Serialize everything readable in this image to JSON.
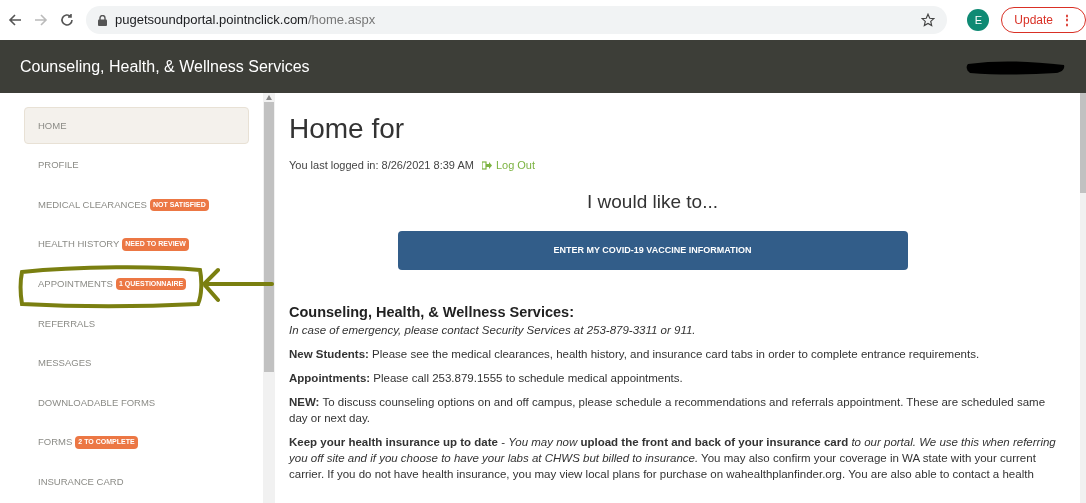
{
  "browser": {
    "url_host": "pugetsoundportal.pointnclick.com",
    "url_path": "/home.aspx",
    "avatar": "E",
    "update_button": "Update",
    "update_menu": "⋮"
  },
  "header": {
    "title": "Counseling, Health, & Wellness Services"
  },
  "sidebar": {
    "items": [
      {
        "label": "HOME",
        "selected": true
      },
      {
        "label": "PROFILE",
        "selected": false
      },
      {
        "label": "MEDICAL CLEARANCES",
        "badge": "NOT SATISFIED",
        "selected": false
      },
      {
        "label": "HEALTH HISTORY",
        "badge": "NEED TO REVIEW",
        "selected": false
      },
      {
        "label": "APPOINTMENTS",
        "badge": "1 QUESTIONNAIRE",
        "selected": false,
        "annotated": true
      },
      {
        "label": "REFERRALS",
        "selected": false
      },
      {
        "label": "MESSAGES",
        "selected": false
      },
      {
        "label": "DOWNLOADABLE FORMS",
        "selected": false
      },
      {
        "label": "FORMS",
        "badge": "2 TO COMPLETE",
        "selected": false
      },
      {
        "label": "INSURANCE CARD",
        "selected": false
      }
    ]
  },
  "main": {
    "title": "Home for",
    "last_login": "You last logged in: 8/26/2021 8:39 AM",
    "logout": "Log Out",
    "prompt": "I would like to...",
    "action_button": "ENTER MY COVID-19 VACCINE INFORMATION",
    "section_title": "Counseling, Health, & Wellness Services:",
    "paragraphs": [
      {
        "kind": "note",
        "text": "In case of emergency, please contact Security Services at 253-879-3311 or 911."
      },
      {
        "kind": "body",
        "text": "**New Students:** Please see the medical clearances, health history, and insurance card tabs in order to complete entrance requirements."
      },
      {
        "kind": "body",
        "text": "**Appointments:** Please call 253.879.1555 to schedule medical appointments."
      },
      {
        "kind": "body",
        "text": "**NEW:** To discuss counseling options on and off campus, please schedule a recommendations and referrals appointment. These are scheduled same day or next day."
      },
      {
        "kind": "body",
        "text": "**Keep your health insurance up to date** - *You may now* **upload the front and back of your insurance card** *to our portal. We use this when referring you off site and if you choose to have your labs at CHWS but billed to insurance.* You may also confirm your coverage in WA state with your current carrier. If you do not have health insurance, you may view local plans for purchase on wahealthplanfinder.org. You are also able to contact a health"
      }
    ]
  }
}
